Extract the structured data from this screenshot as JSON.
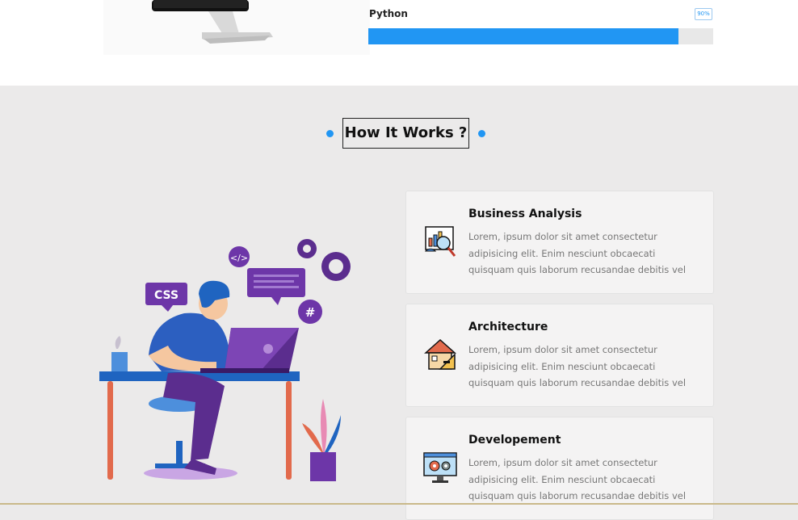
{
  "skills": {
    "label": "Python",
    "percent_label": "90%",
    "percent": 90,
    "bar_color": "#2196f3"
  },
  "section": {
    "title": "How It Works ?"
  },
  "cards": [
    {
      "title": "Business Analysis",
      "text": "Lorem, ipsum dolor sit amet consectetur adipisicing elit. Enim nesciunt obcaecati quisquam quis laborum recusandae debitis vel",
      "icon": "business-analysis-icon"
    },
    {
      "title": "Architecture",
      "text": "Lorem, ipsum dolor sit amet consectetur adipisicing elit. Enim nesciunt obcaecati quisquam quis laborum recusandae debitis vel",
      "icon": "architecture-icon"
    },
    {
      "title": "Developement",
      "text": "Lorem, ipsum dolor sit amet consectetur adipisicing elit. Enim nesciunt obcaecati quisquam quis laborum recusandae debitis vel",
      "icon": "development-icon"
    }
  ],
  "illustration": {
    "css_bubble": "CSS",
    "code_bubble": "</>",
    "hash_bubble": "#"
  }
}
